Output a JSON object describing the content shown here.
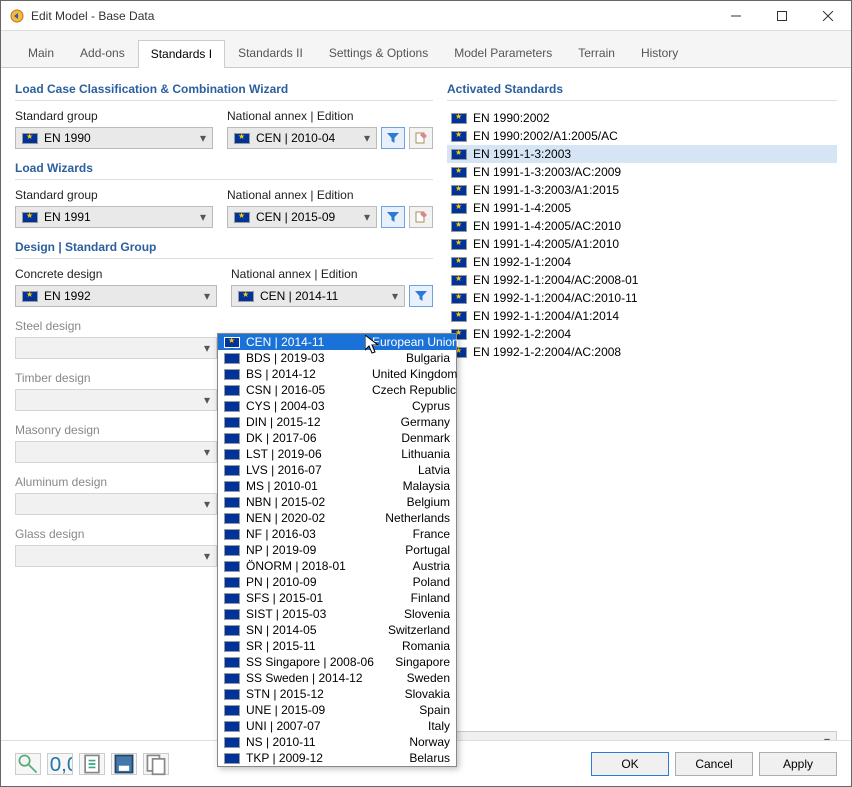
{
  "window": {
    "title": "Edit Model - Base Data"
  },
  "tabs": [
    "Main",
    "Add-ons",
    "Standards I",
    "Standards II",
    "Settings & Options",
    "Model Parameters",
    "Terrain",
    "History"
  ],
  "activeTab": 2,
  "left": {
    "sec1_title": "Load Case Classification & Combination Wizard",
    "stdgroup_label": "Standard group",
    "annex_label": "National annex | Edition",
    "s1_group": "EN 1990",
    "s1_annex": "CEN | 2010-04",
    "sec2_title": "Load Wizards",
    "s2_group": "EN 1991",
    "s2_annex": "CEN | 2015-09",
    "sec3_title": "Design | Standard Group",
    "concrete_label": "Concrete design",
    "concrete_group": "EN 1992",
    "concrete_annex": "CEN | 2014-11",
    "steel_label": "Steel design",
    "timber_label": "Timber design",
    "masonry_label": "Masonry design",
    "aluminum_label": "Aluminum design",
    "glass_label": "Glass design"
  },
  "dropdown": [
    {
      "code": "CEN | 2014-11",
      "country": "European Union",
      "sel": true
    },
    {
      "code": "BDS | 2019-03",
      "country": "Bulgaria"
    },
    {
      "code": "BS | 2014-12",
      "country": "United Kingdom"
    },
    {
      "code": "CSN | 2016-05",
      "country": "Czech Republic"
    },
    {
      "code": "CYS | 2004-03",
      "country": "Cyprus"
    },
    {
      "code": "DIN | 2015-12",
      "country": "Germany"
    },
    {
      "code": "DK | 2017-06",
      "country": "Denmark"
    },
    {
      "code": "LST | 2019-06",
      "country": "Lithuania"
    },
    {
      "code": "LVS | 2016-07",
      "country": "Latvia"
    },
    {
      "code": "MS | 2010-01",
      "country": "Malaysia"
    },
    {
      "code": "NBN | 2015-02",
      "country": "Belgium"
    },
    {
      "code": "NEN | 2020-02",
      "country": "Netherlands"
    },
    {
      "code": "NF | 2016-03",
      "country": "France"
    },
    {
      "code": "NP | 2019-09",
      "country": "Portugal"
    },
    {
      "code": "ÖNORM | 2018-01",
      "country": "Austria"
    },
    {
      "code": "PN | 2010-09",
      "country": "Poland"
    },
    {
      "code": "SFS | 2015-01",
      "country": "Finland"
    },
    {
      "code": "SIST | 2015-03",
      "country": "Slovenia"
    },
    {
      "code": "SN | 2014-05",
      "country": "Switzerland"
    },
    {
      "code": "SR | 2015-11",
      "country": "Romania"
    },
    {
      "code": "SS Singapore | 2008-06",
      "country": "Singapore"
    },
    {
      "code": "SS Sweden | 2014-12",
      "country": "Sweden"
    },
    {
      "code": "STN | 2015-12",
      "country": "Slovakia"
    },
    {
      "code": "UNE | 2015-09",
      "country": "Spain"
    },
    {
      "code": "UNI | 2007-07",
      "country": "Italy"
    },
    {
      "code": "NS | 2010-11",
      "country": "Norway"
    },
    {
      "code": "TKP | 2009-12",
      "country": "Belarus"
    }
  ],
  "right": {
    "title": "Activated Standards",
    "items": [
      {
        "t": "EN 1990:2002"
      },
      {
        "t": "EN 1990:2002/A1:2005/AC"
      },
      {
        "t": "EN 1991-1-3:2003",
        "sel": true
      },
      {
        "t": "EN 1991-1-3:2003/AC:2009"
      },
      {
        "t": "EN 1991-1-3:2003/A1:2015"
      },
      {
        "t": "EN 1991-1-4:2005"
      },
      {
        "t": "EN 1991-1-4:2005/AC:2010"
      },
      {
        "t": "EN 1991-1-4:2005/A1:2010"
      },
      {
        "t": "EN 1992-1-1:2004"
      },
      {
        "t": "EN 1992-1-1:2004/AC:2008-01"
      },
      {
        "t": "EN 1992-1-1:2004/AC:2010-11"
      },
      {
        "t": "EN 1992-1-1:2004/A1:2014"
      },
      {
        "t": "EN 1992-1-2:2004"
      },
      {
        "t": "EN 1992-1-2:2004/AC:2008"
      }
    ]
  },
  "footer": {
    "ok": "OK",
    "cancel": "Cancel",
    "apply": "Apply"
  }
}
